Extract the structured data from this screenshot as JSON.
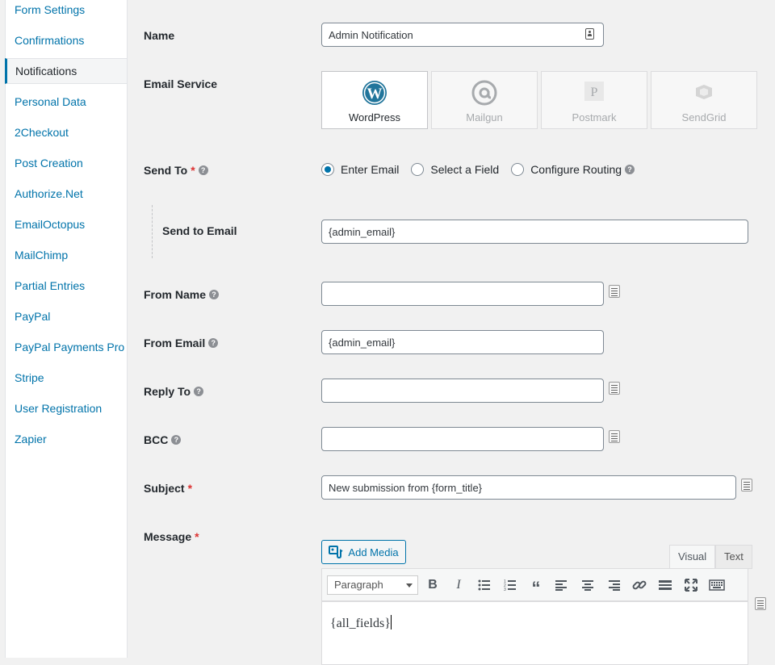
{
  "sidebar": {
    "items": [
      {
        "label": "Form Settings"
      },
      {
        "label": "Confirmations"
      },
      {
        "label": "Notifications",
        "active": true
      },
      {
        "label": "Personal Data"
      },
      {
        "label": "2Checkout"
      },
      {
        "label": "Post Creation"
      },
      {
        "label": "Authorize.Net"
      },
      {
        "label": "EmailOctopus"
      },
      {
        "label": "MailChimp"
      },
      {
        "label": "Partial Entries"
      },
      {
        "label": "PayPal"
      },
      {
        "label": "PayPal Payments Pro"
      },
      {
        "label": "Stripe"
      },
      {
        "label": "User Registration"
      },
      {
        "label": "Zapier"
      }
    ]
  },
  "form": {
    "name": {
      "label": "Name",
      "value": "Admin Notification"
    },
    "email_service": {
      "label": "Email Service",
      "options": [
        {
          "label": "WordPress",
          "selected": true,
          "icon": "wordpress-icon"
        },
        {
          "label": "Mailgun",
          "selected": false,
          "icon": "mailgun-icon"
        },
        {
          "label": "Postmark",
          "selected": false,
          "icon": "postmark-icon"
        },
        {
          "label": "SendGrid",
          "selected": false,
          "icon": "sendgrid-icon"
        }
      ]
    },
    "send_to": {
      "label": "Send To",
      "required_mark": "*",
      "options": [
        {
          "label": "Enter Email",
          "selected": true
        },
        {
          "label": "Select a Field",
          "selected": false
        },
        {
          "label": "Configure Routing",
          "selected": false
        }
      ]
    },
    "send_to_email": {
      "label": "Send to Email",
      "value": "{admin_email}"
    },
    "from_name": {
      "label": "From Name",
      "value": ""
    },
    "from_email": {
      "label": "From Email",
      "value": "{admin_email}"
    },
    "reply_to": {
      "label": "Reply To",
      "value": ""
    },
    "bcc": {
      "label": "BCC",
      "value": ""
    },
    "subject": {
      "label": "Subject",
      "required_mark": "*",
      "value": "New submission from {form_title}"
    },
    "message": {
      "label": "Message",
      "required_mark": "*",
      "add_media_label": "Add Media",
      "tabs": {
        "visual": "Visual",
        "text": "Text"
      },
      "format_select": "Paragraph",
      "content": "{all_fields}"
    }
  },
  "colors": {
    "accent": "#0073aa",
    "required": "#dc3232"
  }
}
